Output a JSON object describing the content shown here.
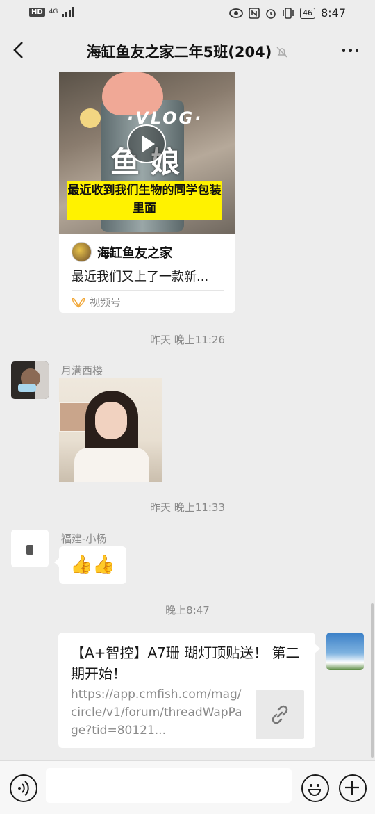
{
  "status_bar": {
    "hd": "HD",
    "network": "4G",
    "battery": "46",
    "time": "8:47"
  },
  "nav": {
    "title": "海缸鱼友之家二年5班(204)"
  },
  "messages": {
    "video_card": {
      "thumb_vlog": "·VLOG·",
      "thumb_chars": "鱼娘",
      "caption": "最近收到我们生物的同学包装里面",
      "author": "海缸鱼友之家",
      "description": "最近我们又上了一款新...",
      "source": "视频号"
    },
    "time_1": "昨天 晚上11:26",
    "msg_photo": {
      "sender": "月满西楼"
    },
    "time_2": "昨天 晚上11:33",
    "msg_thumbs": {
      "sender": "福建-小杨",
      "text": "👍👍"
    },
    "time_3": "晚上8:47",
    "link_msg": {
      "title": "【A+智控】A7珊 瑚灯顶贴送！ 第二期开始！",
      "url": "https://app.cmfish.com/mag/circle/v1/forum/threadWapPage?tid=80121..."
    }
  },
  "input_bar": {
    "placeholder": ""
  },
  "icons": {
    "back": "chevron-left-icon",
    "mute": "bell-off-icon",
    "more": "more-icon",
    "play": "play-icon",
    "channels": "channels-icon",
    "link": "link-icon",
    "voice": "voice-icon",
    "emoji": "emoji-icon",
    "plus": "plus-icon"
  }
}
